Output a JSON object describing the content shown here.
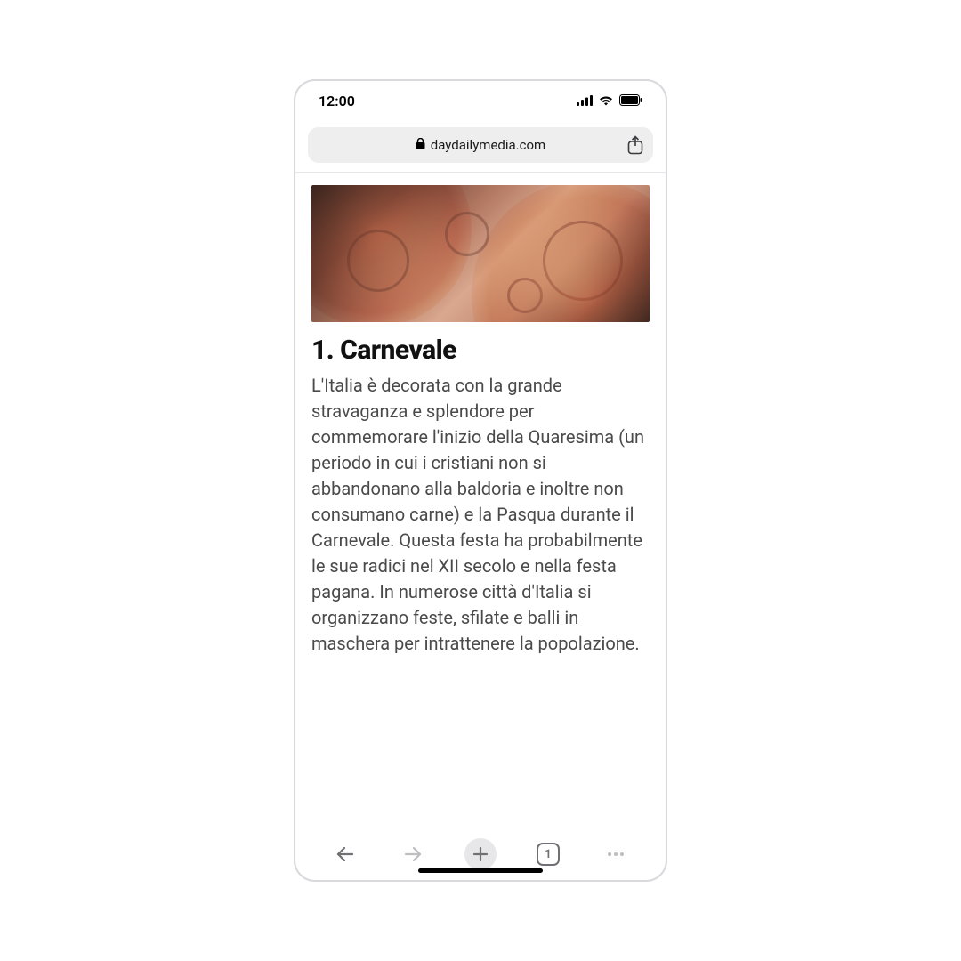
{
  "status": {
    "time": "12:00"
  },
  "addressbar": {
    "domain": "daydailymedia.com"
  },
  "article": {
    "heading": "1. Carnevale",
    "body": "L'Italia è decorata con la grande stravaganza e splendore per commemorare l'inizio della Quaresima (un periodo in cui i cristiani non si abbandonano alla baldoria e inoltre non consumano carne) e la Pasqua durante il Carnevale. Questa festa ha probabilmente le sue radici nel XII secolo e nella festa pagana. In numerose città d'Italia si organizzano feste, sfilate e balli in maschera per intrattenere la popolazione."
  },
  "toolbar": {
    "tab_count": "1"
  }
}
